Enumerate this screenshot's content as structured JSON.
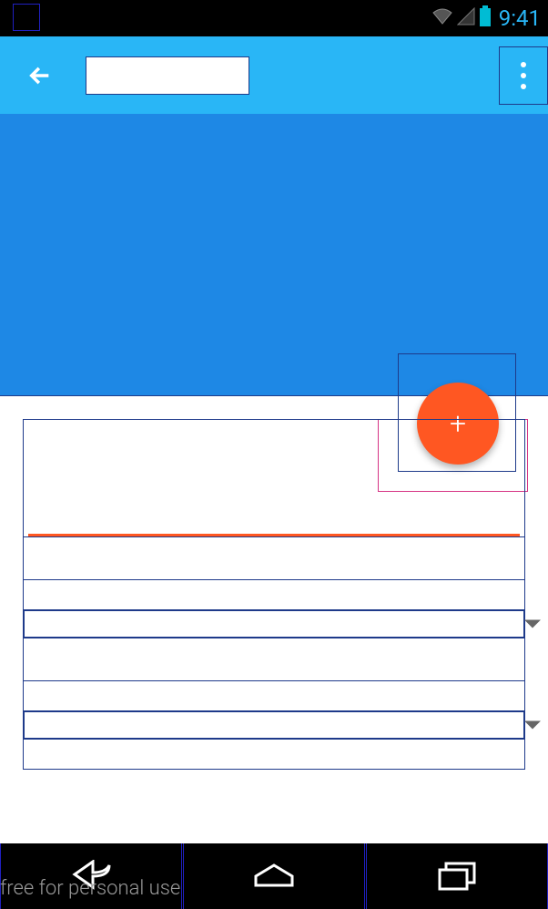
{
  "status": {
    "time": "9:41"
  },
  "appbar": {
    "title": ""
  },
  "fab": {
    "symbol": "+"
  },
  "watermark": "free for personal use"
}
